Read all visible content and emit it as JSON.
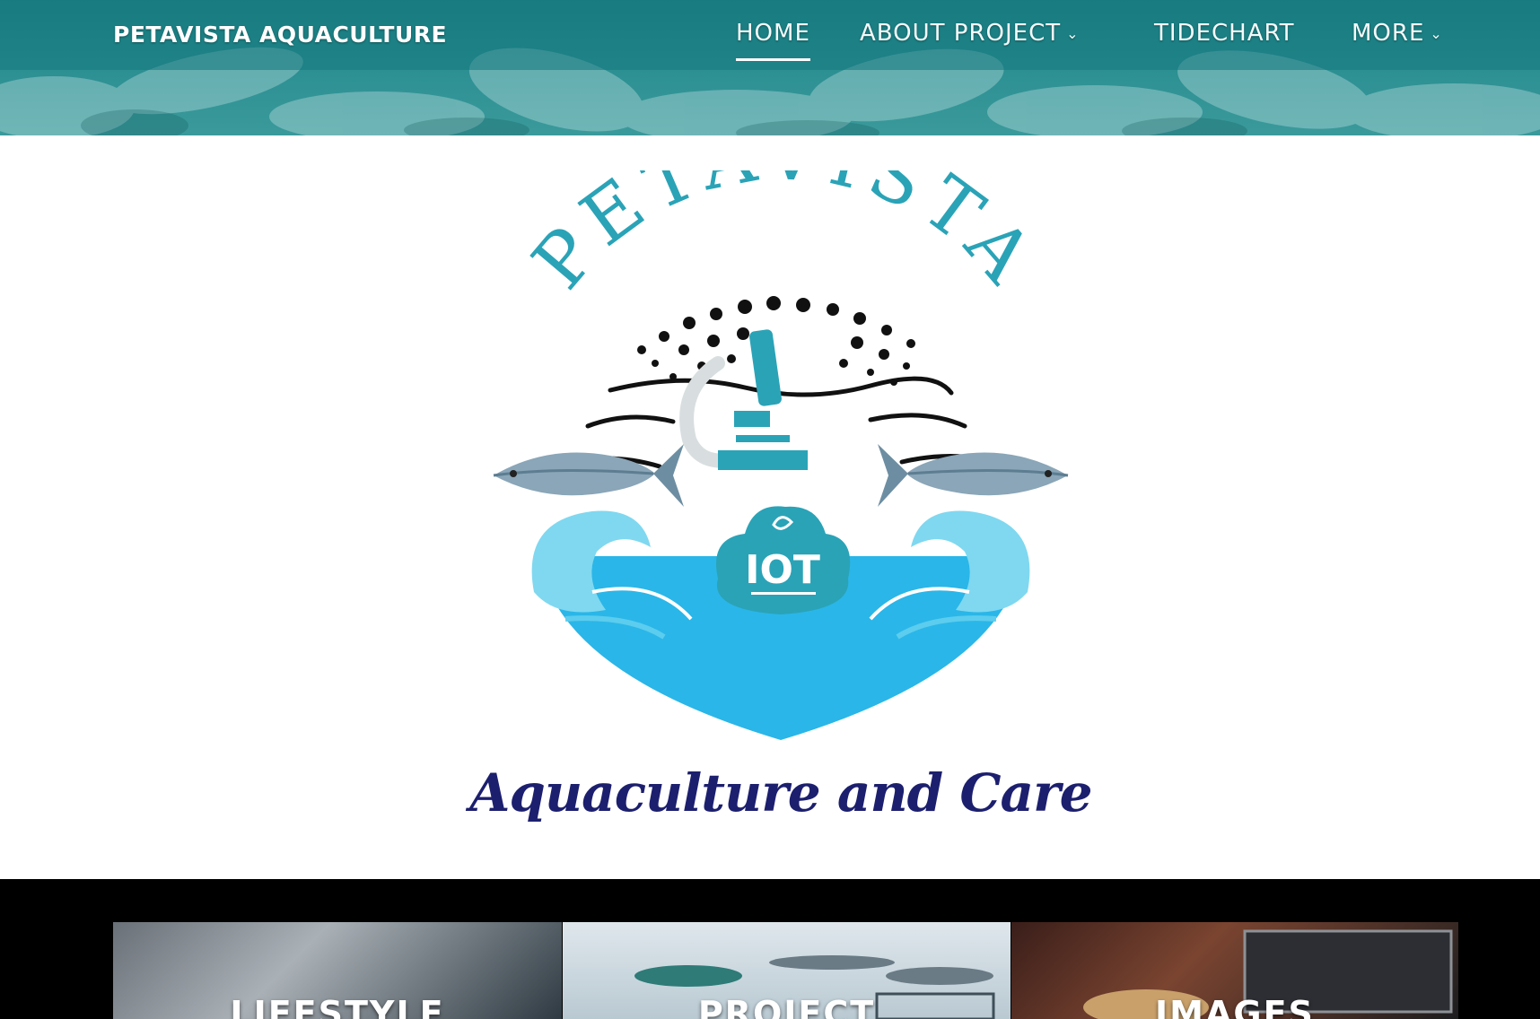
{
  "header": {
    "site_title": "PETAVISTA AQUACULTURE",
    "nav": {
      "home": "HOME",
      "about": "ABOUT PROJECT",
      "tidechart": "TIDECHART",
      "more": "MORE"
    }
  },
  "logo": {
    "arc_text": "PETAVISTA",
    "badge_text": "IOT",
    "tagline": "Aquaculture and Care"
  },
  "cards": [
    {
      "title": "LIFESTYLE"
    },
    {
      "title": "PROJECT"
    },
    {
      "title": "IMAGES"
    }
  ],
  "colors": {
    "header": "#1e7f83",
    "logo_teal": "#2aa3b7",
    "water": "#2ab6e8",
    "tagline": "#1c1f6e"
  }
}
